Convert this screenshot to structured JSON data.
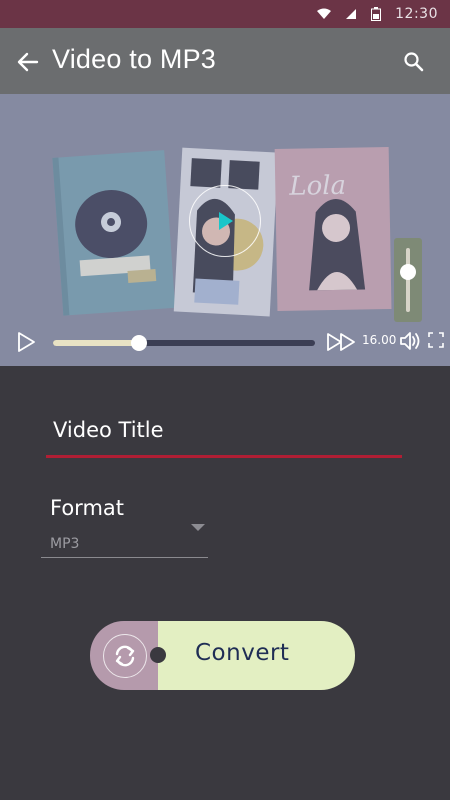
{
  "status_bar": {
    "time": "12:30",
    "icons": [
      "wifi-icon",
      "signal-icon",
      "battery-icon"
    ]
  },
  "app_bar": {
    "title": "Video to MP3",
    "back_icon": "arrow-left-icon",
    "search_icon": "search-icon"
  },
  "player": {
    "time": "16.00",
    "progress_fraction": 0.33,
    "volume_fraction": 0.62,
    "icons": [
      "play-icon",
      "fast-forward-icon",
      "volume-icon",
      "fullscreen-icon",
      "play-overlay-icon"
    ],
    "accent_color": "#19c6c9"
  },
  "form": {
    "title_value": "Video Title",
    "format_label": "Format",
    "format_value": "MP3",
    "underline_color": "#b01e34"
  },
  "convert_button": {
    "label": "Convert",
    "icon": "refresh-icon",
    "left_color": "#b59aac",
    "right_color": "#e3efc2"
  }
}
